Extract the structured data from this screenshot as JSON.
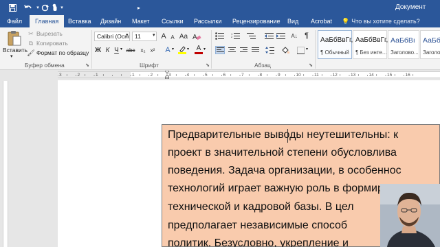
{
  "title_bar": {
    "document_title": "Документ"
  },
  "tabs": [
    {
      "label": "Файл"
    },
    {
      "label": "Главная"
    },
    {
      "label": "Вставка"
    },
    {
      "label": "Дизайн"
    },
    {
      "label": "Макет"
    },
    {
      "label": "Ссылки"
    },
    {
      "label": "Рассылки"
    },
    {
      "label": "Рецензирование"
    },
    {
      "label": "Вид"
    },
    {
      "label": "Acrobat"
    }
  ],
  "tell_me": "Что вы хотите сделать?",
  "clipboard": {
    "paste_label": "Вставить",
    "cut_label": "Вырезать",
    "copy_label": "Копировать",
    "format_painter_label": "Формат по образцу",
    "group_label": "Буфер обмена"
  },
  "font": {
    "font_name": "Calibri (Основ",
    "font_size": "11",
    "grow": "A",
    "shrink": "A",
    "case": "Aa",
    "bold": "Ж",
    "italic": "К",
    "underline": "Ч",
    "strike": "abc",
    "subscript": "x₂",
    "superscript": "x²",
    "effects": "A",
    "font_color": "A",
    "group_label": "Шрифт"
  },
  "paragraph": {
    "group_label": "Абзац",
    "pilcrow": "¶"
  },
  "styles": [
    {
      "sample": "АаБбВвГг,",
      "name": "¶ Обычный"
    },
    {
      "sample": "АаБбВвГг,",
      "name": "¶ Без инте..."
    },
    {
      "sample": "АаБбВı",
      "name": "Заголово..."
    },
    {
      "sample": "АаБбВ",
      "name": "Заголово..."
    }
  ],
  "ruler": {
    "numbers": [
      "3",
      "2",
      "1",
      "1",
      "2",
      "3",
      "4",
      "5",
      "6",
      "7",
      "8",
      "9",
      "10",
      "11",
      "12",
      "13",
      "14",
      "15",
      "16"
    ]
  },
  "document": {
    "lines": [
      "Предварительные выводы неутешительны: к",
      "проект в значительной степени обусловлива",
      "поведения. Задача организации, в особеннос",
      "технологий играет важную роль в формирова",
      "технической и кадровой базы. В цел",
      "предполагает независимые способ",
      "политик. Безусловно, укрепление и"
    ]
  },
  "colors": {
    "accent": "#2b579a",
    "textbox_fill": "#f9cbad",
    "font_color_bar": "#c00000",
    "highlight_bar": "#ffff00"
  }
}
